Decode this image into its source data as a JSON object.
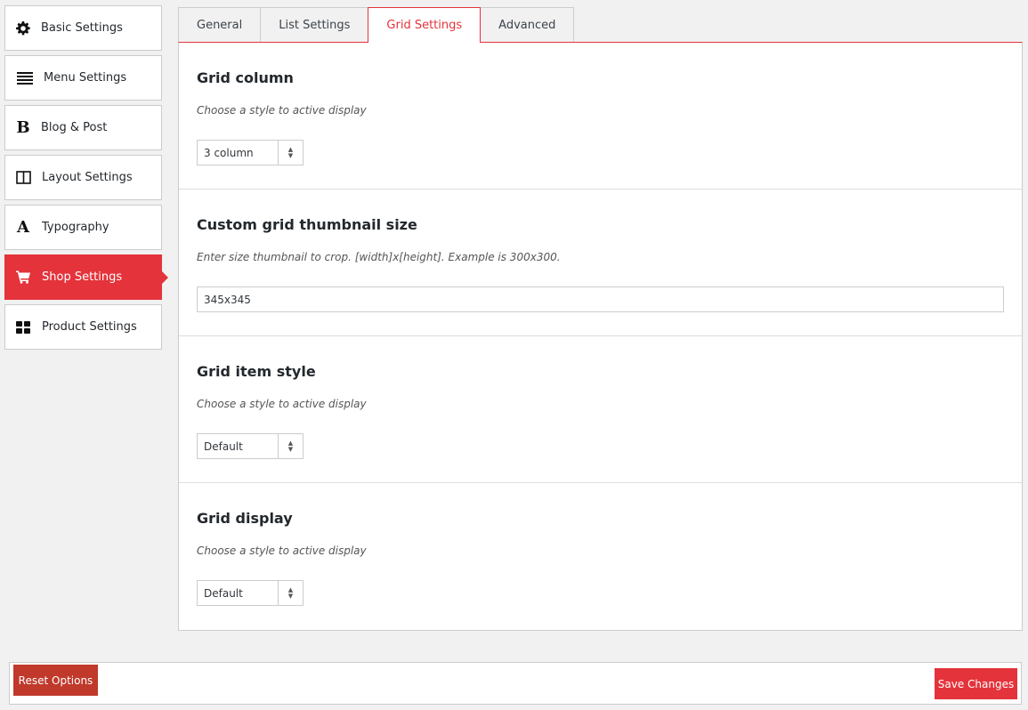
{
  "sidebar": {
    "items": [
      {
        "label": "Basic Settings",
        "icon": "gear-icon"
      },
      {
        "label": "Menu Settings",
        "icon": "menu-lines-icon"
      },
      {
        "label": "Blog & Post",
        "icon": "bold-b-icon"
      },
      {
        "label": "Layout Settings",
        "icon": "columns-icon"
      },
      {
        "label": "Typography",
        "icon": "letter-a-icon"
      },
      {
        "label": "Shop Settings",
        "icon": "cart-icon",
        "active": true
      },
      {
        "label": "Product Settings",
        "icon": "grid-icon"
      }
    ]
  },
  "tabs": [
    {
      "label": "General"
    },
    {
      "label": "List Settings"
    },
    {
      "label": "Grid Settings",
      "active": true
    },
    {
      "label": "Advanced"
    }
  ],
  "sections": {
    "grid_column": {
      "title": "Grid column",
      "description": "Choose a style to active display",
      "value": "3 column"
    },
    "thumbnail_size": {
      "title": "Custom grid thumbnail size",
      "description": "Enter size thumbnail to crop. [width]x[height]. Example is 300x300.",
      "value": "345x345"
    },
    "grid_item_style": {
      "title": "Grid item style",
      "description": "Choose a style to active display",
      "value": "Default"
    },
    "grid_display": {
      "title": "Grid display",
      "description": "Choose a style to active display",
      "value": "Default"
    }
  },
  "footer": {
    "reset_label": "Reset Options",
    "save_label": "Save Changes"
  },
  "colors": {
    "accent": "#e4333b",
    "reset": "#c0392b"
  }
}
